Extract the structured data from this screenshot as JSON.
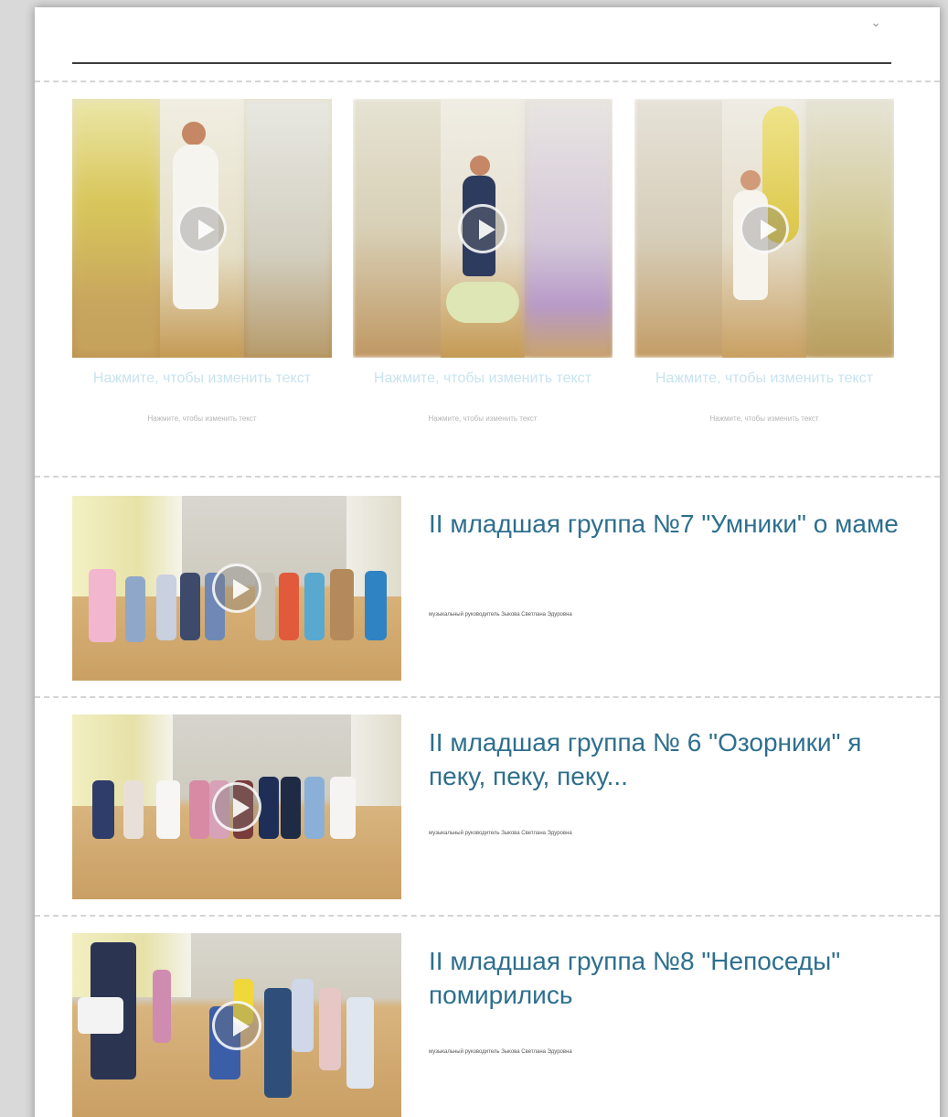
{
  "gallery": [
    {
      "title": "Нажмите, чтобы изменить текст",
      "subtitle": "Нажмите, чтобы изменить текст"
    },
    {
      "title": "Нажмите, чтобы изменить текст",
      "subtitle": "Нажмите, чтобы изменить текст"
    },
    {
      "title": "Нажмите, чтобы изменить текст",
      "subtitle": "Нажмите, чтобы изменить текст"
    }
  ],
  "videos": [
    {
      "title": "II младшая группа №7 \"Умники\" о маме",
      "subtitle": "музыкальный руководитель Зыкова Светлана Эдуровна"
    },
    {
      "title": "II младшая группа № 6 \"Озорники\" я пеку, пеку, пеку...",
      "subtitle": "музыкальный руководитель Зыкова Светлана Эдуровна"
    },
    {
      "title": "II младшая группа №8 \"Непоседы\" помирились",
      "subtitle": "музыкальный руководитель Зыкова Светлана Эдуровна"
    }
  ],
  "icons": {
    "collapse": "chevron-down-icon",
    "play": "play-icon"
  },
  "colors": {
    "title_blue": "#2e6f8e",
    "placeholder_blue": "#c8e3f0"
  }
}
